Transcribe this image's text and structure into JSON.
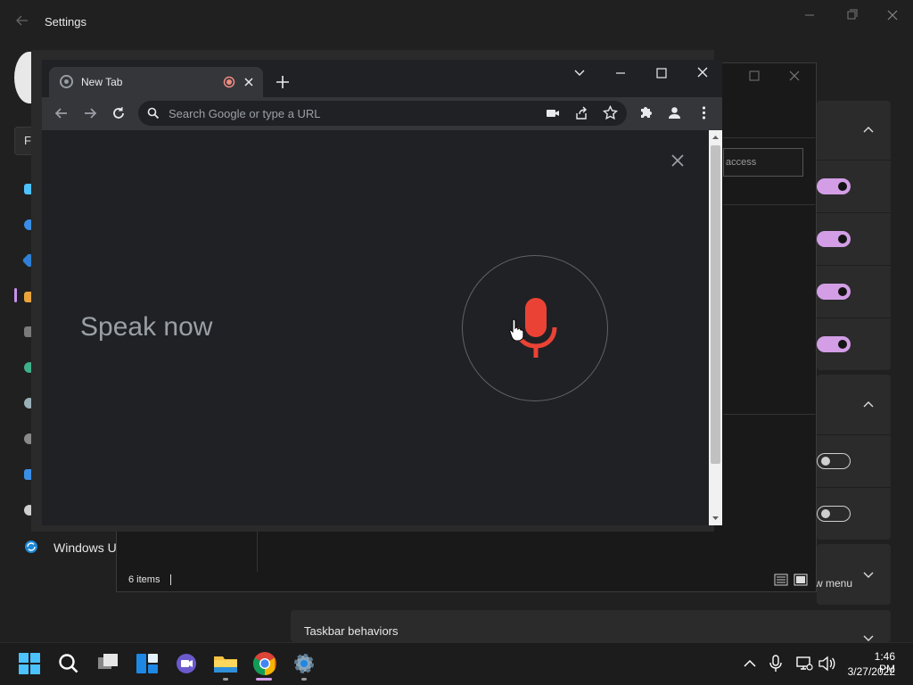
{
  "settings": {
    "title": "Settings",
    "search_placeholder": "Fi",
    "nav_last_label": "Windows U",
    "show_menu_partial": "w menu",
    "taskbar_behaviors_label": "Taskbar behaviors",
    "toggles": [
      {
        "state": "on"
      },
      {
        "state": "on"
      },
      {
        "state": "on"
      },
      {
        "state": "on"
      },
      {
        "state": "off"
      },
      {
        "state": "off"
      }
    ]
  },
  "explorer": {
    "search_placeholder_partial": "access",
    "status_items": "6 items"
  },
  "chrome": {
    "tab_title": "New Tab",
    "omnibox_placeholder": "Search Google or type a URL",
    "voice_prompt": "Speak now",
    "mic_color": "#ea4335"
  },
  "taskbar": {
    "time": "1:46 PM",
    "date": "3/27/2022",
    "apps": [
      "start-icon",
      "search-icon",
      "task-view-icon",
      "widgets-icon",
      "chat-icon",
      "file-explorer-icon",
      "chrome-icon",
      "settings-icon"
    ],
    "tray": [
      "show-hidden-icons-icon",
      "microphone-icon",
      "network-icon",
      "volume-icon"
    ]
  },
  "colors": {
    "accent": "#d39ee6",
    "background": "#202020",
    "chrome_bg": "#202124"
  }
}
